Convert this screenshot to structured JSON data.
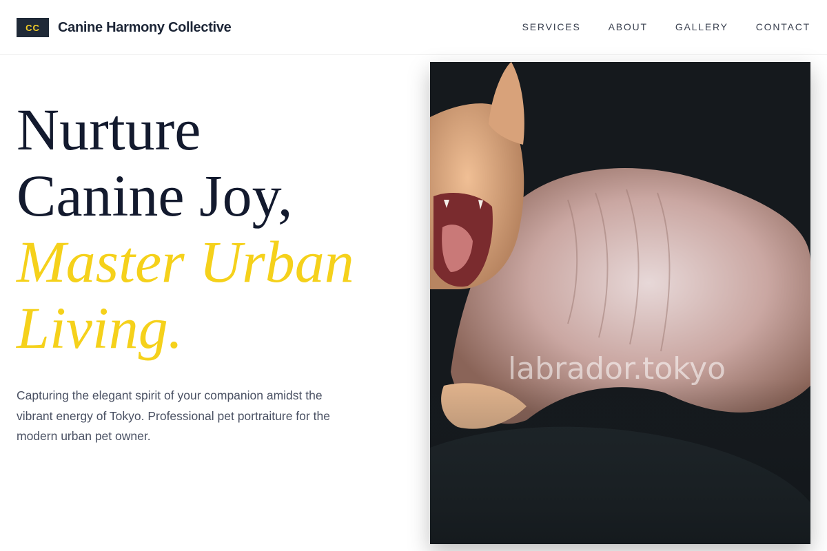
{
  "header": {
    "logo_badge": "CC",
    "brand_name": "Canine Harmony Collective",
    "nav": [
      "SERVICES",
      "ABOUT",
      "GALLERY",
      "CONTACT"
    ]
  },
  "hero": {
    "headline_lines": [
      "Nurture",
      "Canine Joy,"
    ],
    "headline_accent_lines": [
      "Master Urban",
      "Living."
    ],
    "subtext": "Capturing the elegant spirit of your companion amidst the vibrant energy of Tokyo. Professional pet portraiture for the modern urban pet owner.",
    "photo_watermark": "labrador.tokyo"
  },
  "colors": {
    "accent": "#f5d11b",
    "dark": "#1f2937",
    "text": "#131a2e",
    "muted": "#4a5163"
  }
}
